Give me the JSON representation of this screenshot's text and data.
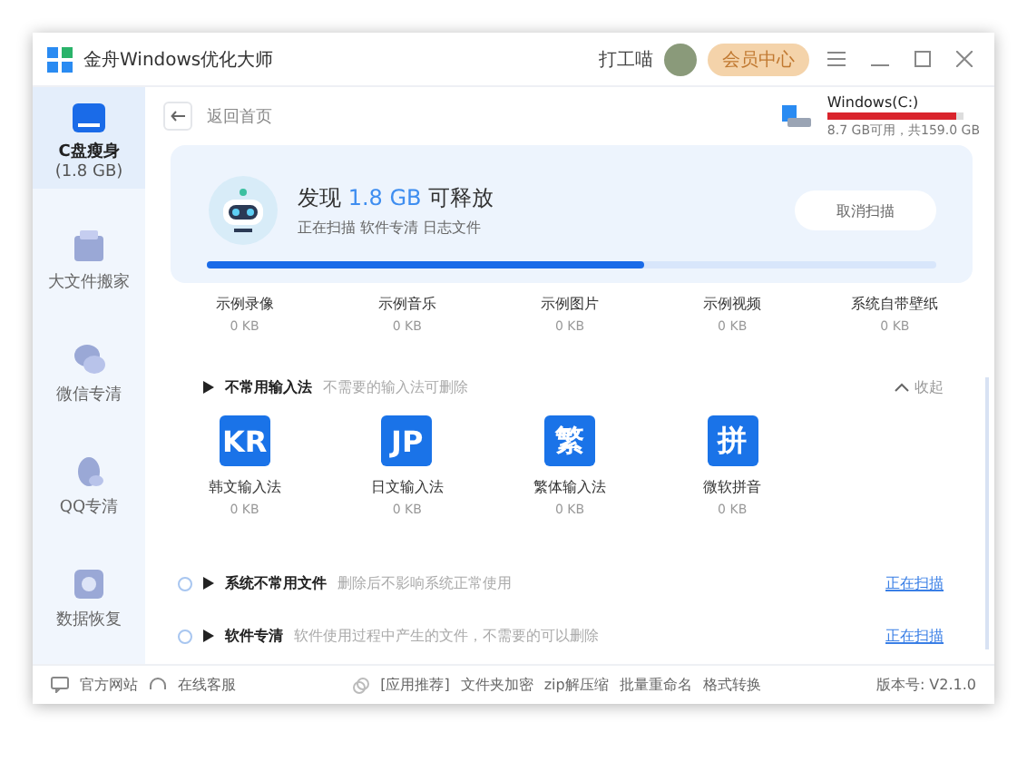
{
  "window": {
    "title": "金舟Windows优化大师",
    "user": "打工喵",
    "vip_button": "会员中心",
    "controls": [
      {
        "kind": "menu"
      },
      {
        "kind": "minimize"
      },
      {
        "kind": "maximize"
      },
      {
        "kind": "close"
      }
    ]
  },
  "sidebar": {
    "items": [
      {
        "kind": "drive",
        "label": "C盘瘦身",
        "sub": "(1.8 GB)",
        "selected": true
      },
      {
        "kind": "box",
        "label": "大文件搬家",
        "selected": false
      },
      {
        "kind": "chat",
        "label": "微信专清",
        "selected": false
      },
      {
        "kind": "penguin",
        "label": "QQ专清",
        "selected": false
      },
      {
        "kind": "chip",
        "label": "数据恢复",
        "selected": false
      }
    ]
  },
  "header": {
    "back": "返回首页",
    "drive": {
      "name": "Windows(C:)",
      "level": 0.95,
      "info": "8.7 GB可用，共159.0 GB"
    }
  },
  "banner": {
    "prefix": "发现",
    "amount": "1.8 GB",
    "suffix": "可释放",
    "status": "正在扫描 软件专清 日志文件",
    "cancel": "取消扫描",
    "level": 0.6
  },
  "media_items": [
    {
      "name": "示例录像",
      "size": "0 KB"
    },
    {
      "name": "示例音乐",
      "size": "0 KB"
    },
    {
      "name": "示例图片",
      "size": "0 KB"
    },
    {
      "name": "示例视频",
      "size": "0 KB"
    },
    {
      "name": "系统自带壁纸",
      "size": "0 KB"
    }
  ],
  "ime_section": {
    "title": "不常用输入法",
    "hint": "不需要的输入法可删除",
    "toggle": "收起",
    "expanded": true,
    "items": [
      {
        "glyph": "KR",
        "name": "韩文输入法",
        "size": "0 KB"
      },
      {
        "glyph": "JP",
        "name": "日文输入法",
        "size": "0 KB"
      },
      {
        "glyph": "繁",
        "name": "繁体输入法",
        "size": "0 KB"
      },
      {
        "glyph": "拼",
        "name": "微软拼音",
        "size": "0 KB"
      }
    ]
  },
  "scan_rows": [
    {
      "title": "系统不常用文件",
      "hint": "删除后不影响系统正常使用",
      "status": "正在扫描",
      "checked": false
    },
    {
      "title": "软件专清",
      "hint": "软件使用过程中产生的文件，不需要的可以删除",
      "status": "正在扫描",
      "checked": false
    }
  ],
  "status_bar": {
    "website": "官方网站",
    "service": "在线客服",
    "recommend": "[应用推荐]",
    "tools": [
      "文件夹加密",
      "zip解压缩",
      "批量重命名",
      "格式转换"
    ],
    "version": "版本号: V2.1.0"
  }
}
